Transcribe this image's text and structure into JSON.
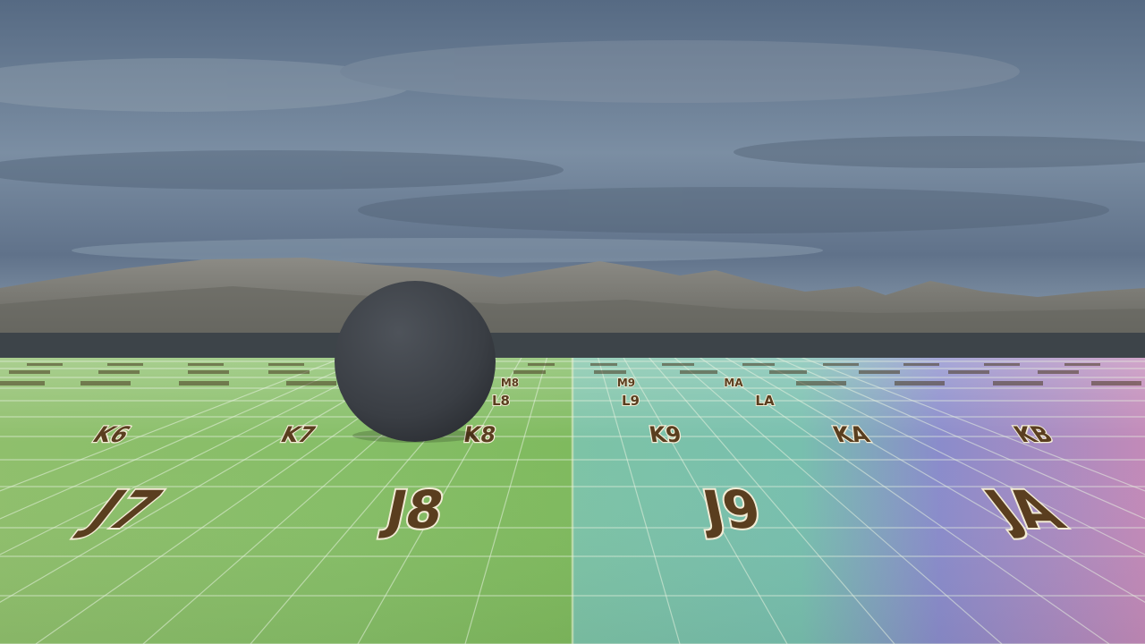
{
  "scene": {
    "kind": "3d-game-viewport",
    "sky": "cloudy-sky",
    "backdrop": "rocky-mountains",
    "water": "lake",
    "floor": "lettered-grid-test-floor",
    "object": "dark-gray-sphere"
  },
  "colors": {
    "sky_top": "#5d7089",
    "sky_mid": "#7b8ea3",
    "sky_horizon": "#8fa1b2",
    "mountain": "#7d7c76",
    "mountain_dark": "#5f5f5a",
    "water": "#3b4247",
    "floor_green": "#86bf6a",
    "floor_teal": "#78c2ad",
    "floor_purple": "#8a86c8",
    "floor_pink": "#c889b0",
    "sphere": "#3c4046",
    "label_fill": "#5a3e1f",
    "label_halo": "#f3ecd6"
  },
  "floor_labels": {
    "front_row": [
      "J7",
      "J8",
      "J9",
      "JA"
    ],
    "mid_row": [
      "K6",
      "K7",
      "K8",
      "K9",
      "KA",
      "KB"
    ],
    "far_row": [
      "L8",
      "L9",
      "LA"
    ],
    "back_row": [
      "M8",
      "M9",
      "MA"
    ]
  }
}
